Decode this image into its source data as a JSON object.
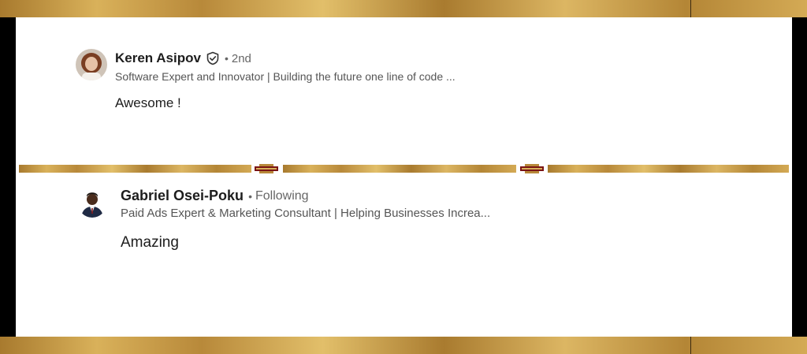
{
  "comments": [
    {
      "author": "Keren Asipov",
      "connection": "2nd",
      "headline": "Software Expert and Innovator | Building the future one line of code ...",
      "text": "Awesome !",
      "verified": true
    },
    {
      "author": "Gabriel Osei-Poku",
      "connection": "Following",
      "headline": "Paid Ads Expert & Marketing Consultant | Helping Businesses Increa...",
      "text": "Amazing",
      "verified": false
    }
  ],
  "separator_glyph": "•",
  "colors": {
    "gold": "#c9a04a",
    "card_background": "#ffffff",
    "text_primary": "#1d1d1d",
    "text_secondary": "#666666"
  }
}
